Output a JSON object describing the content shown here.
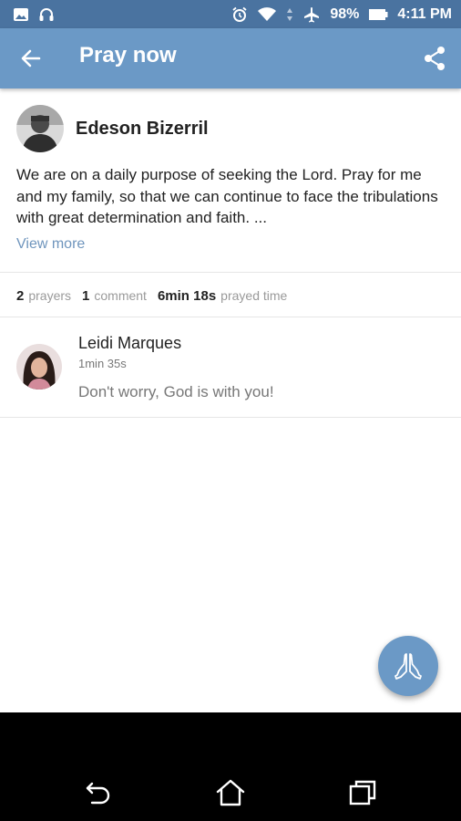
{
  "status_bar": {
    "battery": "98%",
    "time": "4:11 PM",
    "icons": [
      "image-icon",
      "headset-icon",
      "alarm-icon",
      "wifi-icon",
      "data-arrows-icon",
      "airplane-icon",
      "battery-icon"
    ]
  },
  "toolbar": {
    "title": "Pray now",
    "back_icon": "arrow-left-icon",
    "share_icon": "share-icon"
  },
  "post": {
    "author": "Edeson Bizerril",
    "text": "We are on a daily purpose of seeking the Lord. Pray for me and my family, so that we can continue to face the tribulations with great determination and faith. ...",
    "view_more": "View more"
  },
  "stats": {
    "prayers_count": "2",
    "prayers_label": "prayers",
    "comments_count": "1",
    "comments_label": "comment",
    "prayed_time_value": "6min 18s",
    "prayed_time_label": "prayed time"
  },
  "comments": [
    {
      "name": "Leidi Marques",
      "time": "1min 35s",
      "text": "Don't worry, God is with you!"
    }
  ],
  "fab": {
    "icon": "praying-hands-icon"
  },
  "nav_bar": {
    "icons": [
      "back-nav-icon",
      "home-nav-icon",
      "recents-nav-icon"
    ]
  },
  "colors": {
    "status_bar": "#4a73a0",
    "toolbar": "#6b99c6",
    "link": "#6f95bd",
    "fab": "#6b99c6"
  }
}
